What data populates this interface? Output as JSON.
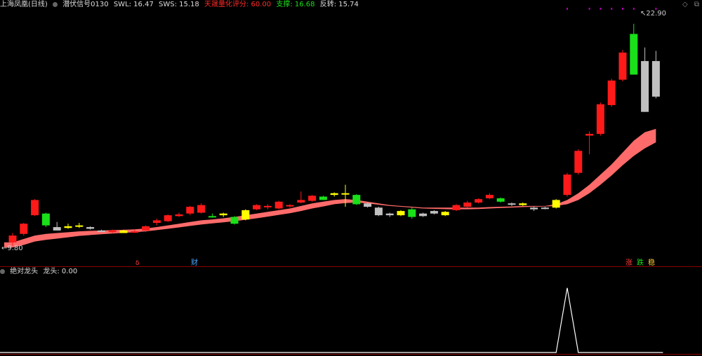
{
  "header": {
    "stock_name": "上海凤凰(日线)",
    "indicator_name": "潜伏信号0130",
    "swl": "SWL: 16.47",
    "sws": "SWS: 15.18",
    "score": "天晟量化评分: 60.00",
    "support": "支撑: 16.68",
    "reversal": "反转: 15.74"
  },
  "sub_header": {
    "indicator_name": "绝对龙头",
    "value": "龙头: 0.00"
  },
  "window_icons": {
    "diamond": "◇",
    "restore": "⧉"
  },
  "markers": {
    "cai": "财",
    "d": "δ",
    "zhang": "涨",
    "die": "跌",
    "wen": "稳"
  },
  "colors": {
    "up": "#ff1a1a",
    "down": "#19e019",
    "neutral_up": "#ffff00",
    "neutral_down": "#c0c0c0",
    "band": "#ff6b6b",
    "signal": "#ffffff",
    "divider": "#8b0000",
    "dots": "#b000b0"
  },
  "chart_data": [
    {
      "type": "candlestick",
      "ylim": [
        9.0,
        23.6
      ],
      "price_labels": {
        "low": "9.80",
        "high": "22.90"
      },
      "low_point": 9.8,
      "high_point": 22.9,
      "candles": [
        {
          "o": 10.0,
          "h": 10.55,
          "l": 9.8,
          "c": 10.4,
          "color": "up"
        },
        {
          "o": 10.5,
          "h": 11.15,
          "l": 10.4,
          "c": 11.1,
          "color": "up"
        },
        {
          "o": 11.6,
          "h": 12.55,
          "l": 11.55,
          "c": 12.5,
          "color": "up"
        },
        {
          "o": 11.7,
          "h": 11.75,
          "l": 10.9,
          "c": 11.0,
          "color": "down"
        },
        {
          "o": 10.9,
          "h": 11.2,
          "l": 10.7,
          "c": 10.7,
          "color": "neutral_down"
        },
        {
          "o": 10.85,
          "h": 11.1,
          "l": 10.8,
          "c": 10.95,
          "color": "neutral_up"
        },
        {
          "o": 10.95,
          "h": 11.15,
          "l": 10.85,
          "c": 11.0,
          "color": "neutral_up"
        },
        {
          "o": 10.9,
          "h": 10.95,
          "l": 10.75,
          "c": 10.8,
          "color": "neutral_down"
        },
        {
          "o": 10.7,
          "h": 10.75,
          "l": 10.6,
          "c": 10.65,
          "color": "neutral_down"
        },
        {
          "o": 10.6,
          "h": 10.75,
          "l": 10.55,
          "c": 10.7,
          "color": "up"
        },
        {
          "o": 10.7,
          "h": 10.75,
          "l": 10.55,
          "c": 10.55,
          "color": "neutral_up"
        },
        {
          "o": 10.6,
          "h": 10.75,
          "l": 10.55,
          "c": 10.65,
          "color": "up"
        },
        {
          "o": 10.7,
          "h": 11.0,
          "l": 10.6,
          "c": 10.95,
          "color": "up"
        },
        {
          "o": 11.15,
          "h": 11.4,
          "l": 11.0,
          "c": 11.3,
          "color": "up"
        },
        {
          "o": 11.25,
          "h": 11.65,
          "l": 11.2,
          "c": 11.6,
          "color": "up"
        },
        {
          "o": 11.55,
          "h": 11.75,
          "l": 11.5,
          "c": 11.65,
          "color": "up"
        },
        {
          "o": 11.7,
          "h": 12.15,
          "l": 11.6,
          "c": 12.1,
          "color": "up"
        },
        {
          "o": 11.75,
          "h": 12.3,
          "l": 11.7,
          "c": 12.2,
          "color": "up"
        },
        {
          "o": 11.55,
          "h": 11.7,
          "l": 11.45,
          "c": 11.5,
          "color": "down"
        },
        {
          "o": 11.6,
          "h": 11.75,
          "l": 11.5,
          "c": 11.7,
          "color": "neutral_up"
        },
        {
          "o": 11.5,
          "h": 11.55,
          "l": 11.05,
          "c": 11.1,
          "color": "down"
        },
        {
          "o": 11.35,
          "h": 11.95,
          "l": 11.3,
          "c": 11.9,
          "color": "neutral_up"
        },
        {
          "o": 11.95,
          "h": 12.25,
          "l": 11.9,
          "c": 12.2,
          "color": "up"
        },
        {
          "o": 12.1,
          "h": 12.25,
          "l": 11.95,
          "c": 12.15,
          "color": "up"
        },
        {
          "o": 12.0,
          "h": 12.45,
          "l": 11.95,
          "c": 12.4,
          "color": "up"
        },
        {
          "o": 12.15,
          "h": 12.25,
          "l": 12.05,
          "c": 12.2,
          "color": "up"
        },
        {
          "o": 12.35,
          "h": 13.0,
          "l": 12.3,
          "c": 12.5,
          "color": "up"
        },
        {
          "o": 12.45,
          "h": 12.8,
          "l": 12.4,
          "c": 12.75,
          "color": "up"
        },
        {
          "o": 12.7,
          "h": 12.75,
          "l": 12.5,
          "c": 12.5,
          "color": "down"
        },
        {
          "o": 12.8,
          "h": 12.95,
          "l": 12.7,
          "c": 12.9,
          "color": "neutral_up"
        },
        {
          "o": 12.85,
          "h": 13.4,
          "l": 12.1,
          "c": 12.9,
          "color": "neutral_up"
        },
        {
          "o": 12.8,
          "h": 12.85,
          "l": 12.2,
          "c": 12.25,
          "color": "down"
        },
        {
          "o": 12.3,
          "h": 12.35,
          "l": 12.05,
          "c": 12.1,
          "color": "neutral_down"
        },
        {
          "o": 12.05,
          "h": 12.1,
          "l": 11.55,
          "c": 11.6,
          "color": "neutral_down"
        },
        {
          "o": 11.6,
          "h": 11.75,
          "l": 11.5,
          "c": 11.7,
          "color": "neutral_down"
        },
        {
          "o": 11.6,
          "h": 11.9,
          "l": 11.55,
          "c": 11.85,
          "color": "neutral_up"
        },
        {
          "o": 11.95,
          "h": 12.05,
          "l": 11.4,
          "c": 11.5,
          "color": "down"
        },
        {
          "o": 11.55,
          "h": 11.75,
          "l": 11.5,
          "c": 11.7,
          "color": "neutral_down"
        },
        {
          "o": 11.7,
          "h": 11.9,
          "l": 11.65,
          "c": 11.85,
          "color": "neutral_down"
        },
        {
          "o": 11.6,
          "h": 11.85,
          "l": 11.55,
          "c": 11.8,
          "color": "neutral_up"
        },
        {
          "o": 11.9,
          "h": 12.25,
          "l": 11.85,
          "c": 12.2,
          "color": "up"
        },
        {
          "o": 12.1,
          "h": 12.45,
          "l": 12.05,
          "c": 12.35,
          "color": "up"
        },
        {
          "o": 12.35,
          "h": 12.6,
          "l": 12.3,
          "c": 12.55,
          "color": "up"
        },
        {
          "o": 12.6,
          "h": 12.9,
          "l": 12.55,
          "c": 12.8,
          "color": "up"
        },
        {
          "o": 12.6,
          "h": 12.65,
          "l": 12.35,
          "c": 12.4,
          "color": "down"
        },
        {
          "o": 12.25,
          "h": 12.35,
          "l": 12.15,
          "c": 12.3,
          "color": "neutral_down"
        },
        {
          "o": 12.3,
          "h": 12.35,
          "l": 12.15,
          "c": 12.2,
          "color": "neutral_up"
        },
        {
          "o": 12.05,
          "h": 12.1,
          "l": 11.85,
          "c": 11.95,
          "color": "neutral_down"
        },
        {
          "o": 12.0,
          "h": 12.1,
          "l": 11.95,
          "c": 12.05,
          "color": "neutral_down"
        },
        {
          "o": 12.05,
          "h": 12.55,
          "l": 12.0,
          "c": 12.5,
          "color": "neutral_up"
        },
        {
          "o": 12.8,
          "h": 14.1,
          "l": 12.7,
          "c": 14.0,
          "color": "up"
        },
        {
          "o": 14.1,
          "h": 15.5,
          "l": 14.0,
          "c": 15.4,
          "color": "up"
        },
        {
          "o": 16.4,
          "h": 16.55,
          "l": 15.2,
          "c": 16.3,
          "color": "up"
        },
        {
          "o": 16.4,
          "h": 18.25,
          "l": 16.3,
          "c": 18.15,
          "color": "up"
        },
        {
          "o": 18.1,
          "h": 19.65,
          "l": 18.0,
          "c": 19.55,
          "color": "up"
        },
        {
          "o": 19.6,
          "h": 21.35,
          "l": 19.5,
          "c": 21.2,
          "color": "up"
        },
        {
          "o": 22.3,
          "h": 22.9,
          "l": 19.9,
          "c": 19.9,
          "color": "down"
        },
        {
          "o": 20.7,
          "h": 21.5,
          "l": 17.7,
          "c": 17.7,
          "color": "neutral_down"
        },
        {
          "o": 20.7,
          "h": 21.3,
          "l": 18.5,
          "c": 18.6,
          "color": "neutral_down"
        }
      ],
      "band_upper": [
        10.0,
        10.2,
        10.4,
        10.5,
        10.55,
        10.6,
        10.65,
        10.68,
        10.7,
        10.72,
        10.74,
        10.77,
        10.82,
        10.9,
        11.0,
        11.1,
        11.2,
        11.3,
        11.35,
        11.42,
        11.5,
        11.6,
        11.7,
        11.8,
        11.9,
        12.0,
        12.15,
        12.3,
        12.4,
        12.5,
        12.55,
        12.5,
        12.4,
        12.3,
        12.2,
        12.15,
        12.1,
        12.05,
        12.05,
        12.05,
        12.05,
        12.05,
        12.05,
        12.08,
        12.1,
        12.12,
        12.15,
        12.15,
        12.15,
        12.25,
        12.5,
        12.9,
        13.4,
        14.0,
        14.6,
        15.3,
        16.0,
        16.5,
        16.7
      ],
      "band_lower": [
        9.7,
        9.85,
        10.05,
        10.15,
        10.22,
        10.3,
        10.38,
        10.43,
        10.48,
        10.52,
        10.56,
        10.6,
        10.65,
        10.72,
        10.8,
        10.88,
        10.97,
        11.05,
        11.12,
        11.18,
        11.25,
        11.33,
        11.42,
        11.52,
        11.62,
        11.72,
        11.85,
        12.0,
        12.12,
        12.25,
        12.32,
        12.35,
        12.3,
        12.22,
        12.15,
        12.1,
        12.05,
        12.0,
        11.98,
        11.96,
        11.95,
        11.95,
        11.97,
        12.0,
        12.03,
        12.05,
        12.08,
        12.1,
        12.12,
        12.15,
        12.25,
        12.5,
        12.9,
        13.4,
        13.95,
        14.55,
        15.1,
        15.55,
        15.9
      ]
    },
    {
      "type": "line",
      "name": "龙头",
      "ylim": [
        0,
        1.15
      ],
      "values": [
        0,
        0,
        0,
        0,
        0,
        0,
        0,
        0,
        0,
        0,
        0,
        0,
        0,
        0,
        0,
        0,
        0,
        0,
        0,
        0,
        0,
        0,
        0,
        0,
        0,
        0,
        0,
        0,
        0,
        0,
        0,
        0,
        0,
        0,
        0,
        0,
        0,
        0,
        0,
        0,
        0,
        0,
        0,
        0,
        0,
        0,
        0,
        0,
        0,
        0,
        1,
        0,
        0,
        0,
        0,
        0,
        0,
        0,
        0
      ]
    }
  ]
}
